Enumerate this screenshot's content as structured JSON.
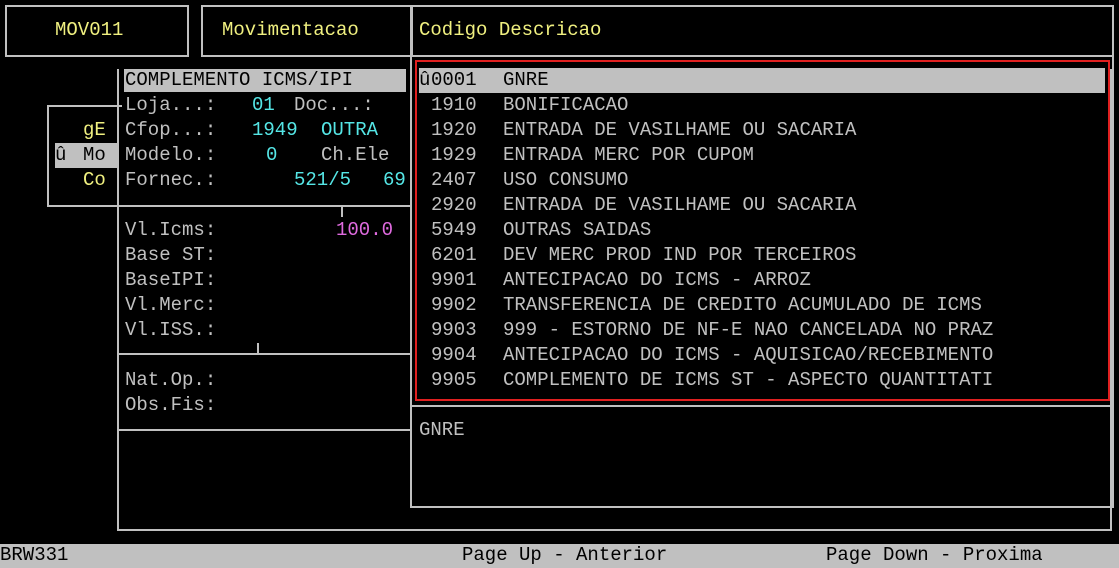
{
  "header": {
    "program_code": "MOV011",
    "program_name": "Movimentacao",
    "list_header": "Codigo Descricao"
  },
  "side_menu": {
    "items": [
      {
        "label": "gE"
      },
      {
        "marker": "û",
        "label": "Mo"
      },
      {
        "label": "Co"
      }
    ]
  },
  "form": {
    "title": "COMPLEMENTO ICMS/IPI",
    "loja_label": "Loja...:",
    "loja_value": "01",
    "doc_label": "Doc...:",
    "cfop_label": "Cfop...:",
    "cfop_value": "1949",
    "cfop_desc": "OUTRA",
    "modelo_label": "Modelo.:",
    "modelo_value": "0",
    "chele_label": "Ch.Ele",
    "fornec_label": "Fornec.:",
    "fornec_value": "521/5",
    "fornec_extra": "69",
    "vl_icms_label": "Vl.Icms:",
    "vl_icms_value": "100.0",
    "base_st_label": "Base ST:",
    "base_ipi_label": "BaseIPI:",
    "vl_merc_label": "Vl.Merc:",
    "vl_iss_label": "Vl.ISS.:",
    "nat_op_label": "Nat.Op.:",
    "obs_fis_label": "Obs.Fis:"
  },
  "list": {
    "selected_marker": "û",
    "items": [
      {
        "code": "0001",
        "desc": "GNRE"
      },
      {
        "code": "1910",
        "desc": "BONIFICACAO"
      },
      {
        "code": "1920",
        "desc": "ENTRADA DE VASILHAME OU SACARIA"
      },
      {
        "code": "1929",
        "desc": "ENTRADA MERC POR CUPOM"
      },
      {
        "code": "2407",
        "desc": "USO CONSUMO"
      },
      {
        "code": "2920",
        "desc": "ENTRADA DE VASILHAME OU SACARIA"
      },
      {
        "code": "5949",
        "desc": "OUTRAS SAIDAS"
      },
      {
        "code": "6201",
        "desc": "DEV MERC PROD IND POR TERCEIROS"
      },
      {
        "code": "9901",
        "desc": "ANTECIPACAO DO ICMS - ARROZ"
      },
      {
        "code": "9902",
        "desc": "TRANSFERENCIA DE CREDITO ACUMULADO DE ICMS"
      },
      {
        "code": "9903",
        "desc": "999 - ESTORNO DE NF-E NAO CANCELADA NO PRAZ"
      },
      {
        "code": "9904",
        "desc": "ANTECIPACAO DO ICMS - AQUISICAO/RECEBIMENTO"
      },
      {
        "code": "9905",
        "desc": "COMPLEMENTO DE ICMS ST - ASPECTO QUANTITATI"
      }
    ],
    "detail_text": "GNRE"
  },
  "status_bar": {
    "screen_code": "BRW331",
    "page_up": "Page Up - Anterior",
    "page_down": "Page Down - Proxima"
  },
  "colors": {
    "background": "#000000",
    "frame": "#c0c0c0",
    "label_yellow": "#f0f080",
    "value_cyan": "#55e6e6",
    "value_magenta": "#e06be0",
    "selection_frame": "#e02020"
  }
}
